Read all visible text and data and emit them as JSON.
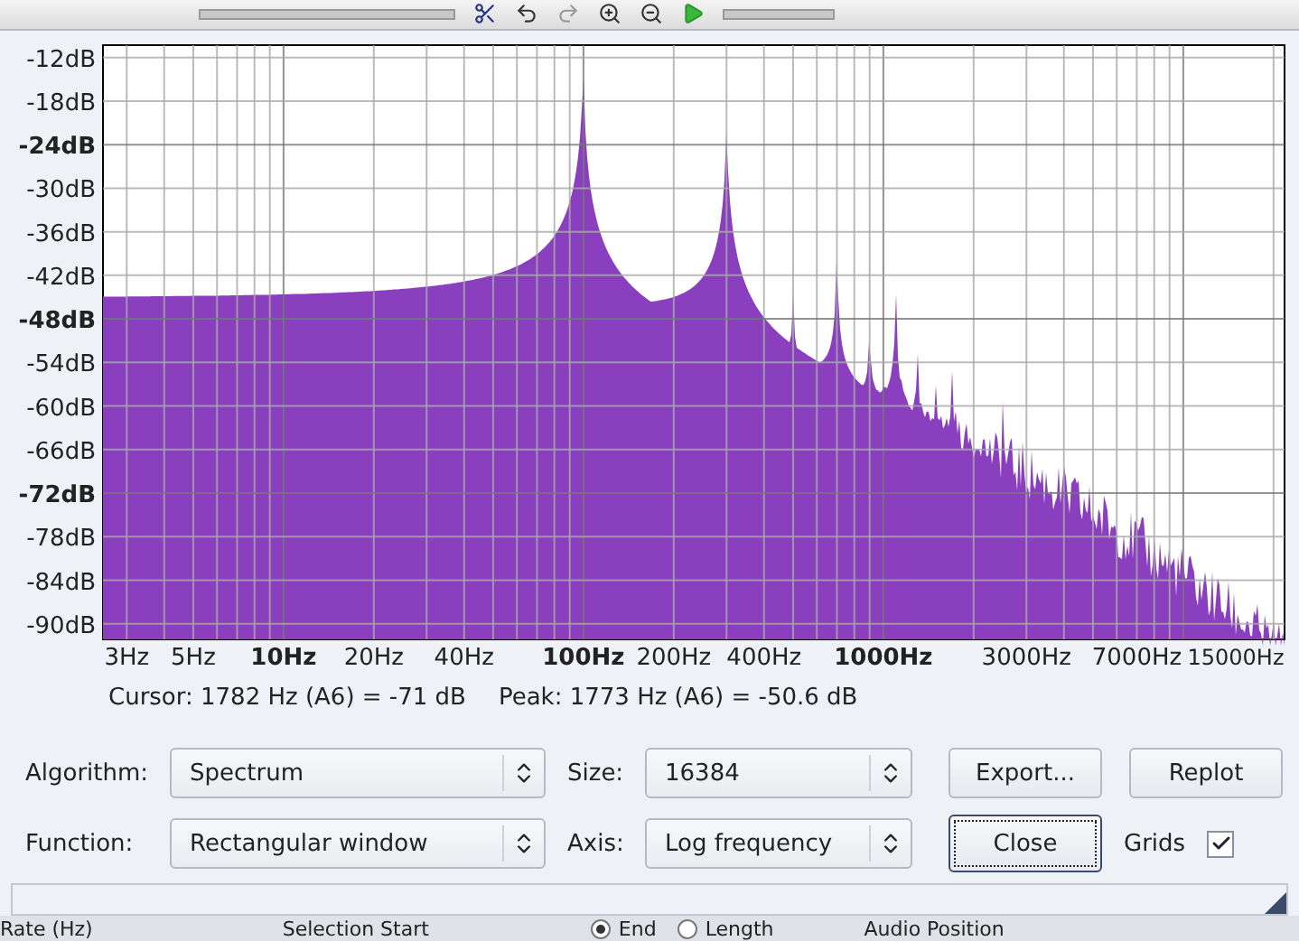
{
  "plot": {
    "y_labels": [
      {
        "text": "-12dB",
        "major": false
      },
      {
        "text": "-18dB",
        "major": false
      },
      {
        "text": "-24dB",
        "major": true
      },
      {
        "text": "-30dB",
        "major": false
      },
      {
        "text": "-36dB",
        "major": false
      },
      {
        "text": "-42dB",
        "major": false
      },
      {
        "text": "-48dB",
        "major": true
      },
      {
        "text": "-54dB",
        "major": false
      },
      {
        "text": "-60dB",
        "major": false
      },
      {
        "text": "-66dB",
        "major": false
      },
      {
        "text": "-72dB",
        "major": true
      },
      {
        "text": "-78dB",
        "major": false
      },
      {
        "text": "-84dB",
        "major": false
      },
      {
        "text": "-90dB",
        "major": false
      }
    ],
    "x_labels": [
      {
        "text": "3Hz",
        "major": false
      },
      {
        "text": "5Hz",
        "major": false
      },
      {
        "text": "10Hz",
        "major": true
      },
      {
        "text": "20Hz",
        "major": false
      },
      {
        "text": "40Hz",
        "major": false
      },
      {
        "text": "100Hz",
        "major": true
      },
      {
        "text": "200Hz",
        "major": false
      },
      {
        "text": "400Hz",
        "major": false
      },
      {
        "text": "1000Hz",
        "major": true
      },
      {
        "text": "3000Hz",
        "major": false
      },
      {
        "text": "7000Hz",
        "major": false
      },
      {
        "text": "15000Hz",
        "major": false
      }
    ]
  },
  "readout": {
    "cursor": "Cursor: 1782 Hz (A6) = -71 dB",
    "peak": "Peak: 1773 Hz (A6) = -50.6 dB"
  },
  "algorithm": {
    "label": "Algorithm:",
    "value": "Spectrum"
  },
  "size": {
    "label": "Size:",
    "value": "16384"
  },
  "function": {
    "label": "Function:",
    "value": "Rectangular window"
  },
  "axis": {
    "label": "Axis:",
    "value": "Log frequency"
  },
  "buttons": [
    {
      "label": "Export...",
      "focused": false
    },
    {
      "label": "Replot",
      "focused": false
    },
    {
      "label": "Close",
      "focused": true
    }
  ],
  "grids": {
    "label": "Grids",
    "checked": true
  },
  "status_bar": {
    "items": [
      {
        "kind": "label",
        "text": "Rate (Hz)"
      },
      {
        "kind": "label",
        "text": "Selection Start"
      },
      {
        "kind": "radio",
        "text": "End",
        "selected": true
      },
      {
        "kind": "radio",
        "text": "Length",
        "selected": false
      },
      {
        "kind": "label",
        "text": "Audio Position"
      }
    ]
  }
}
